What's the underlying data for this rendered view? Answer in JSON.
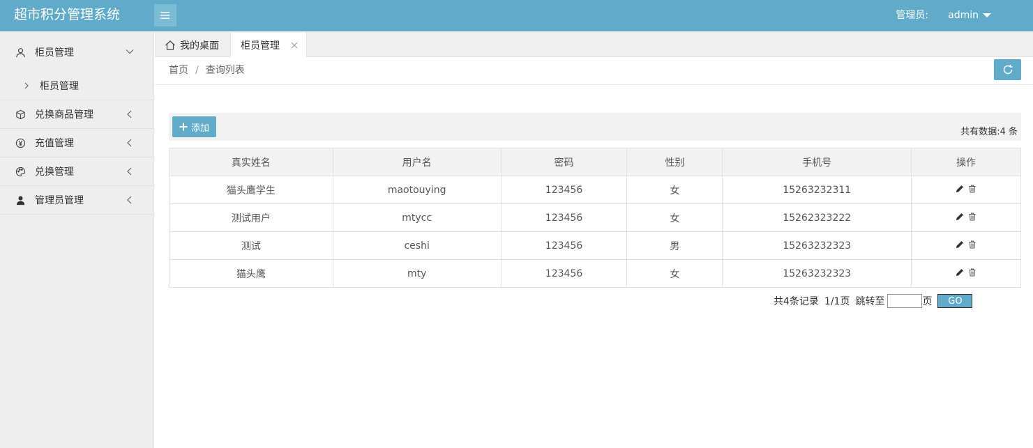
{
  "app": {
    "title": "超市积分管理系统"
  },
  "header": {
    "admin_label": "管理员:",
    "admin_name": "admin"
  },
  "sidebar": {
    "items": [
      {
        "label": "柜员管理",
        "icon": "user-icon",
        "expanded": true,
        "children": [
          {
            "label": "柜员管理"
          }
        ]
      },
      {
        "label": "兑换商品管理",
        "icon": "cube-icon",
        "expanded": false
      },
      {
        "label": "充值管理",
        "icon": "yen-icon",
        "expanded": false
      },
      {
        "label": "兑换管理",
        "icon": "palette-icon",
        "expanded": false
      },
      {
        "label": "管理员管理",
        "icon": "person-solid-icon",
        "expanded": false
      }
    ]
  },
  "tabs": {
    "home": "我的桌面",
    "active": "柜员管理"
  },
  "breadcrumb": {
    "home": "首页",
    "separator": "/",
    "current": "查询列表"
  },
  "toolbar": {
    "add_label": "添加",
    "total_label": "共有数据:4 条"
  },
  "table": {
    "headers": [
      "真实姓名",
      "用户名",
      "密码",
      "性别",
      "手机号",
      "操作"
    ],
    "rows": [
      {
        "name": "猫头鹰学生",
        "username": "maotouying",
        "password": "123456",
        "gender": "女",
        "phone": "15263232311"
      },
      {
        "name": "测试用户",
        "username": "mtycc",
        "password": "123456",
        "gender": "女",
        "phone": "15262323222"
      },
      {
        "name": "测试",
        "username": "ceshi",
        "password": "123456",
        "gender": "男",
        "phone": "15263232323"
      },
      {
        "name": "猫头鹰",
        "username": "mty",
        "password": "123456",
        "gender": "女",
        "phone": "15263232323"
      }
    ]
  },
  "pager": {
    "records": "共4条记录",
    "pages": "1/1页",
    "jump_label": "跳转至",
    "page_unit": "页",
    "jump_value": "",
    "go_label": "GO"
  },
  "colors": {
    "primary": "#5fabc9",
    "sidebar_bg": "#eeeeee"
  }
}
